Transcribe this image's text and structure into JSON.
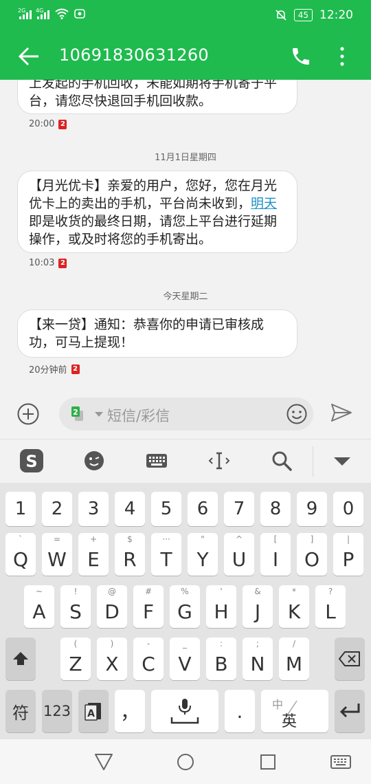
{
  "status": {
    "carrier1": "2G",
    "carrier2": "4G",
    "battery": "45",
    "time": "12:20"
  },
  "header": {
    "title": "10691830631260"
  },
  "messages": [
    {
      "text": "上发起的手机回收，未能如期将手机寄于平台，请您尽快退回手机回收款。",
      "time": "20:00",
      "sim": "2"
    },
    {
      "date": "11月1日星期四",
      "text_before": "【月光优卡】亲爱的用户，您好，您在月光优卡上的卖出的手机，平台尚未收到，",
      "link": "明天",
      "text_after": "即是收货的最终日期，请您上平台进行延期操作，或及时将您的手机寄出。",
      "time": "10:03",
      "sim": "2"
    },
    {
      "date": "今天星期二",
      "text": "【来一贷】通知：恭喜你的申请已审核成功，可马上提现！",
      "time": "20分钟前",
      "sim": "2"
    }
  ],
  "composer": {
    "placeholder": "短信/彩信",
    "sim": "2"
  },
  "keyboard": {
    "digits": [
      "1",
      "2",
      "3",
      "4",
      "5",
      "6",
      "7",
      "8",
      "9",
      "0"
    ],
    "row1": {
      "keys": [
        "Q",
        "W",
        "E",
        "R",
        "T",
        "Y",
        "U",
        "I",
        "O",
        "P"
      ],
      "subs": [
        "`",
        "=",
        "+",
        "$",
        "···",
        "\"",
        "^",
        "[",
        "]",
        "|"
      ]
    },
    "row2": {
      "keys": [
        "A",
        "S",
        "D",
        "F",
        "G",
        "H",
        "J",
        "K",
        "L"
      ],
      "subs": [
        "~",
        "!",
        "@",
        "#",
        "%",
        "'",
        "&",
        "*",
        "?"
      ]
    },
    "row3": {
      "keys": [
        "Z",
        "X",
        "C",
        "V",
        "B",
        "N",
        "M"
      ],
      "subs": [
        "(",
        ")",
        "-",
        "_",
        ":",
        ";",
        "/"
      ]
    },
    "bottom": {
      "symbol": "符",
      "num": "123",
      "comma": "，",
      "period": ".",
      "lang_top": "中",
      "lang_bottom": "英"
    }
  },
  "colors": {
    "accent": "#1fbb4e",
    "link": "#1e90c8"
  }
}
